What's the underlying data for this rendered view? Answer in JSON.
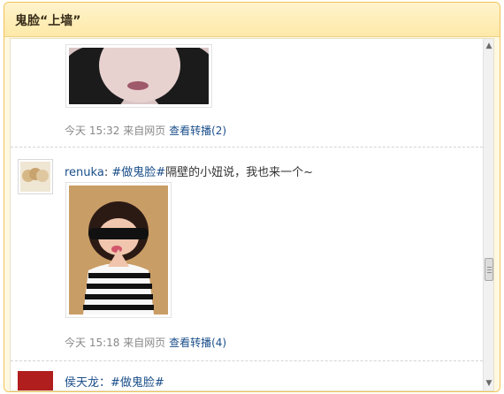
{
  "panel": {
    "title": "鬼脸“上墙”"
  },
  "posts": [
    {
      "meta_time": "今天 15:32",
      "meta_source": "来自网页",
      "meta_action": "查看转播",
      "meta_count": "(2)"
    },
    {
      "username": "renuka",
      "separator": ":",
      "hashtag": "#做鬼脸#",
      "text": "隔壁的小妞说，我也来一个~",
      "meta_time": "今天 15:18",
      "meta_source": "来自网页",
      "meta_action": "查看转播",
      "meta_count": "(4)"
    },
    {
      "partial_text": "侯天龙：#做鬼脸#"
    }
  ],
  "colors": {
    "panel_border": "#f0c25a",
    "link": "#1a4e8a",
    "meta": "#888888"
  },
  "icons": {
    "scroll_up": "triangle-up",
    "scroll_down": "triangle-down"
  }
}
